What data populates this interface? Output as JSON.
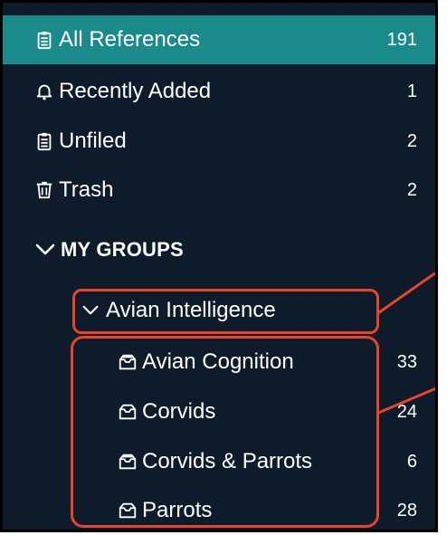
{
  "library": {
    "items": [
      {
        "label": "All References",
        "count": "191",
        "icon": "clipboard-icon",
        "selected": true
      },
      {
        "label": "Recently Added",
        "count": "1",
        "icon": "bell-icon"
      },
      {
        "label": "Unfiled",
        "count": "2",
        "icon": "clipboard-icon"
      },
      {
        "label": "Trash",
        "count": "2",
        "icon": "trash-icon"
      }
    ]
  },
  "groups": {
    "header": "MY GROUPS",
    "group": {
      "label": "Avian Intelligence",
      "items": [
        {
          "label": "Avian Cognition",
          "count": "33",
          "icon": "shared-folder-icon"
        },
        {
          "label": "Corvids",
          "count": "24",
          "icon": "folder-icon"
        },
        {
          "label": "Corvids & Parrots",
          "count": "6",
          "icon": "shared-folder-icon"
        },
        {
          "label": "Parrots",
          "count": "28",
          "icon": "folder-icon"
        }
      ]
    }
  },
  "colors": {
    "background": "#0d1b2a",
    "selected": "#1b8a8a",
    "annotation": "#e8442a"
  }
}
